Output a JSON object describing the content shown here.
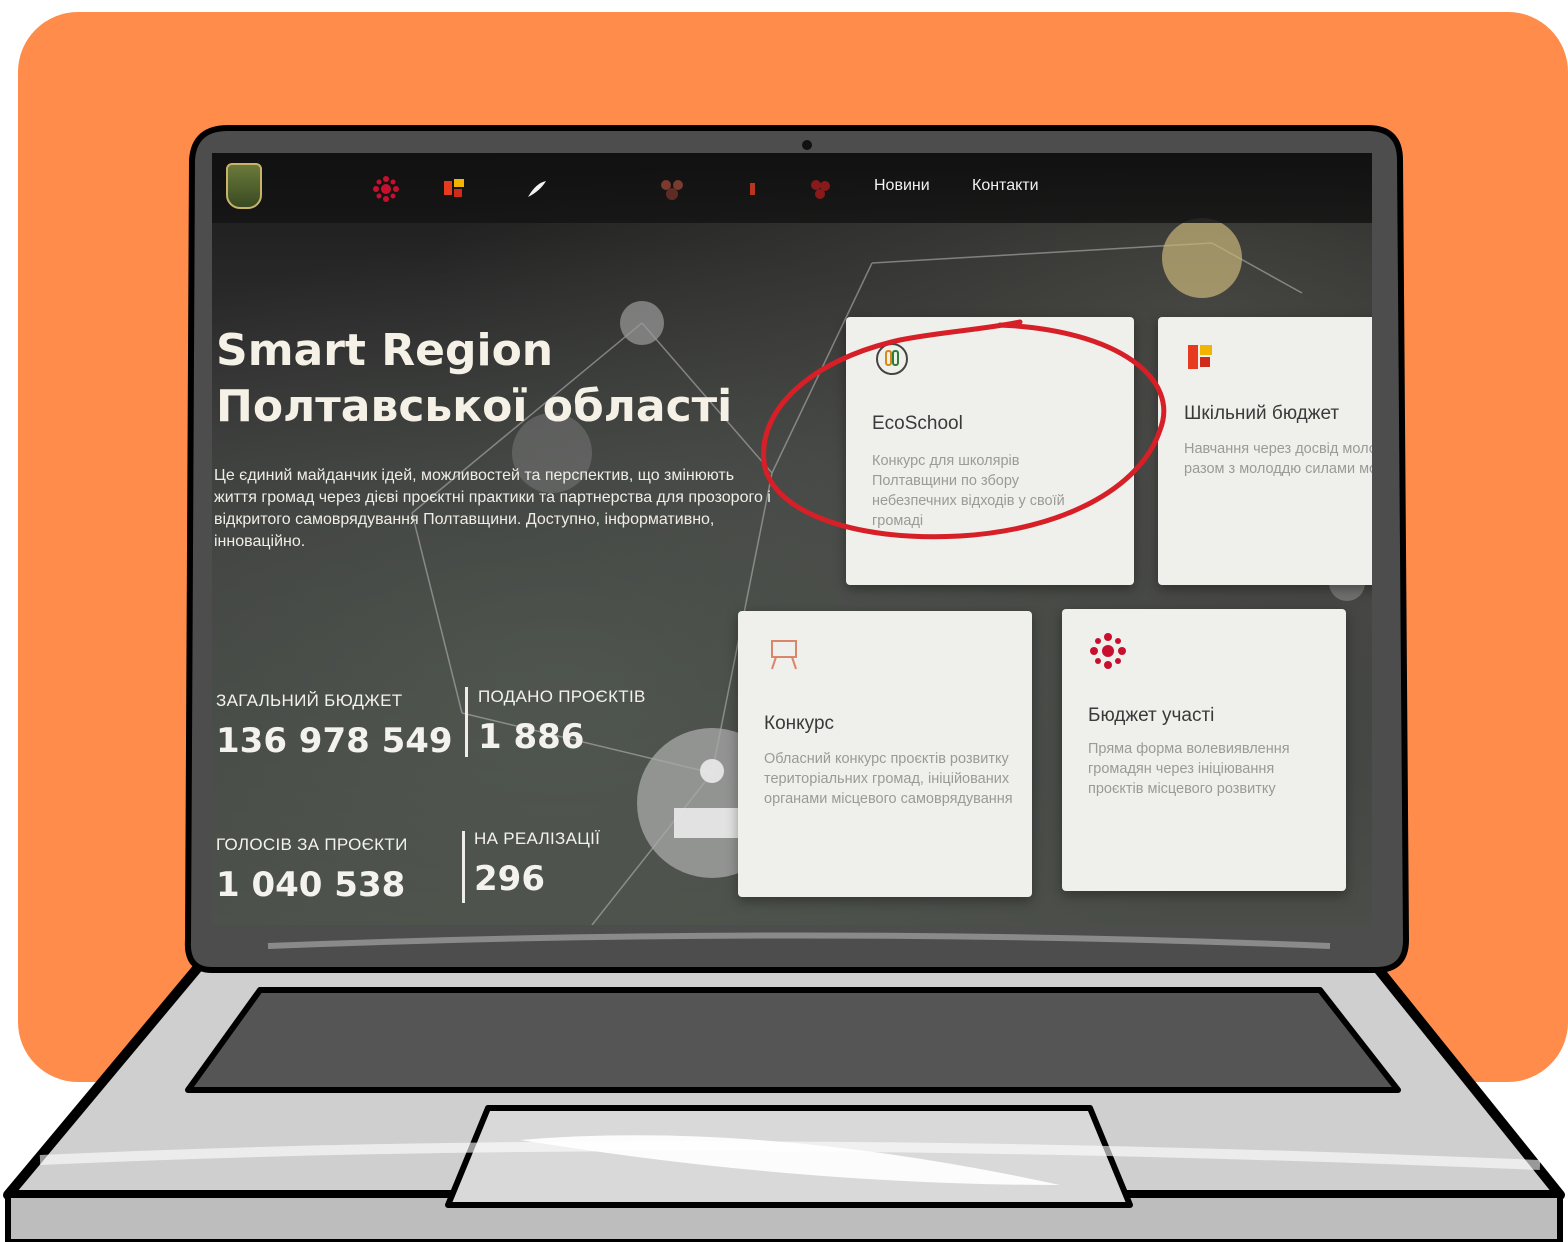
{
  "colors": {
    "background_orange": "#ff8c4a",
    "annotation_red": "#d61f26",
    "card_bg": "#efefec",
    "laptop_frame": "#4d4d4d"
  },
  "header": {
    "nav": [
      "Новини",
      "Контакти"
    ],
    "icons": [
      "coat-of-arms-icon",
      "ornament-icon",
      "people-icon",
      "feather-icon",
      "group-icon",
      "figure-icon",
      "flower-icon"
    ]
  },
  "hero": {
    "title_line1": "Smart Region",
    "title_line2": "Полтавської області",
    "description": "Це єдиний майданчик ідей, можливостей та перспектив, що змінюють життя громад через дієві проєктні практики та партнерства для прозорого і відкритого самоврядування Полтавщини. Доступно, інформативно, інноваційно."
  },
  "stats": [
    {
      "label": "ЗАГАЛЬНИЙ БЮДЖЕТ",
      "value": "136 978 549"
    },
    {
      "label": "ПОДАНО ПРОЄКТІВ",
      "value": "1 886"
    },
    {
      "label": "ГОЛОСІВ ЗА ПРОЄКТИ",
      "value": "1 040 538"
    },
    {
      "label": "НА РЕАЛІЗАЦІЇ",
      "value": "296"
    }
  ],
  "cards": [
    {
      "title": "EcoSchool",
      "description": "Конкурс для школярів Полтавщини по збору небезпечних відходів у своїй громаді",
      "icon": "recycle-icon"
    },
    {
      "title": "Шкільний бюджет",
      "description": "Навчання через досвід молоді, разом з молоддю силами молоді!",
      "icon": "people-icon"
    },
    {
      "title": "Конкурс",
      "description": "Обласний конкурс проєктів розвитку територіальних громад, ініційованих органами місцевого самоврядування",
      "icon": "easel-icon"
    },
    {
      "title": "Бюджет участі",
      "description": "Пряма форма волевиявлення громадян через ініціювання проєктів місцевого розвитку",
      "icon": "ornament-icon"
    }
  ]
}
